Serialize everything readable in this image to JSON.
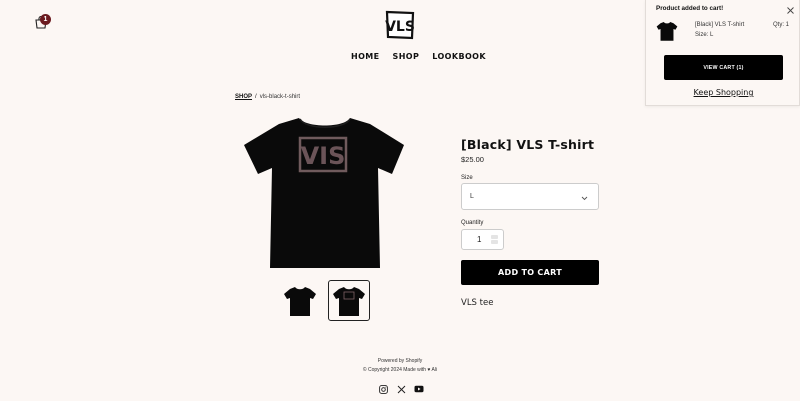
{
  "header": {
    "cart_count": "1",
    "logo_text": "VLS",
    "nav": [
      {
        "label": "HOME"
      },
      {
        "label": "SHOP"
      },
      {
        "label": "LOOKBOOK"
      }
    ]
  },
  "breadcrumb": {
    "parent": "SHOP",
    "separator": "/",
    "current": "vls-black-t-shirt"
  },
  "product": {
    "title": "[Black] VLS T-shirt",
    "price": "$25.00",
    "size_label": "Size",
    "size_value": "L",
    "quantity_label": "Quantity",
    "quantity_value": "1",
    "add_to_cart_label": "ADD TO CART",
    "description": "VLS tee",
    "image_logo": "VIS"
  },
  "footer": {
    "powered_by": "Powered by Shopify",
    "copyright": "© Copyright 2024 Made with ♥ Ali",
    "social_icons": [
      "instagram-icon",
      "x-icon",
      "youtube-icon"
    ]
  },
  "cart_popup": {
    "title": "Product added to cart!",
    "item_name": "[Black] VLS T-shirt",
    "item_size": "Size: L",
    "item_qty": "Qty: 1",
    "view_cart_label": "VIEW CART (1)",
    "keep_shopping_label": "Keep Shopping"
  },
  "colors": {
    "background": "#fcf7f4",
    "badge": "#6b1a1f",
    "button": "#000000"
  }
}
